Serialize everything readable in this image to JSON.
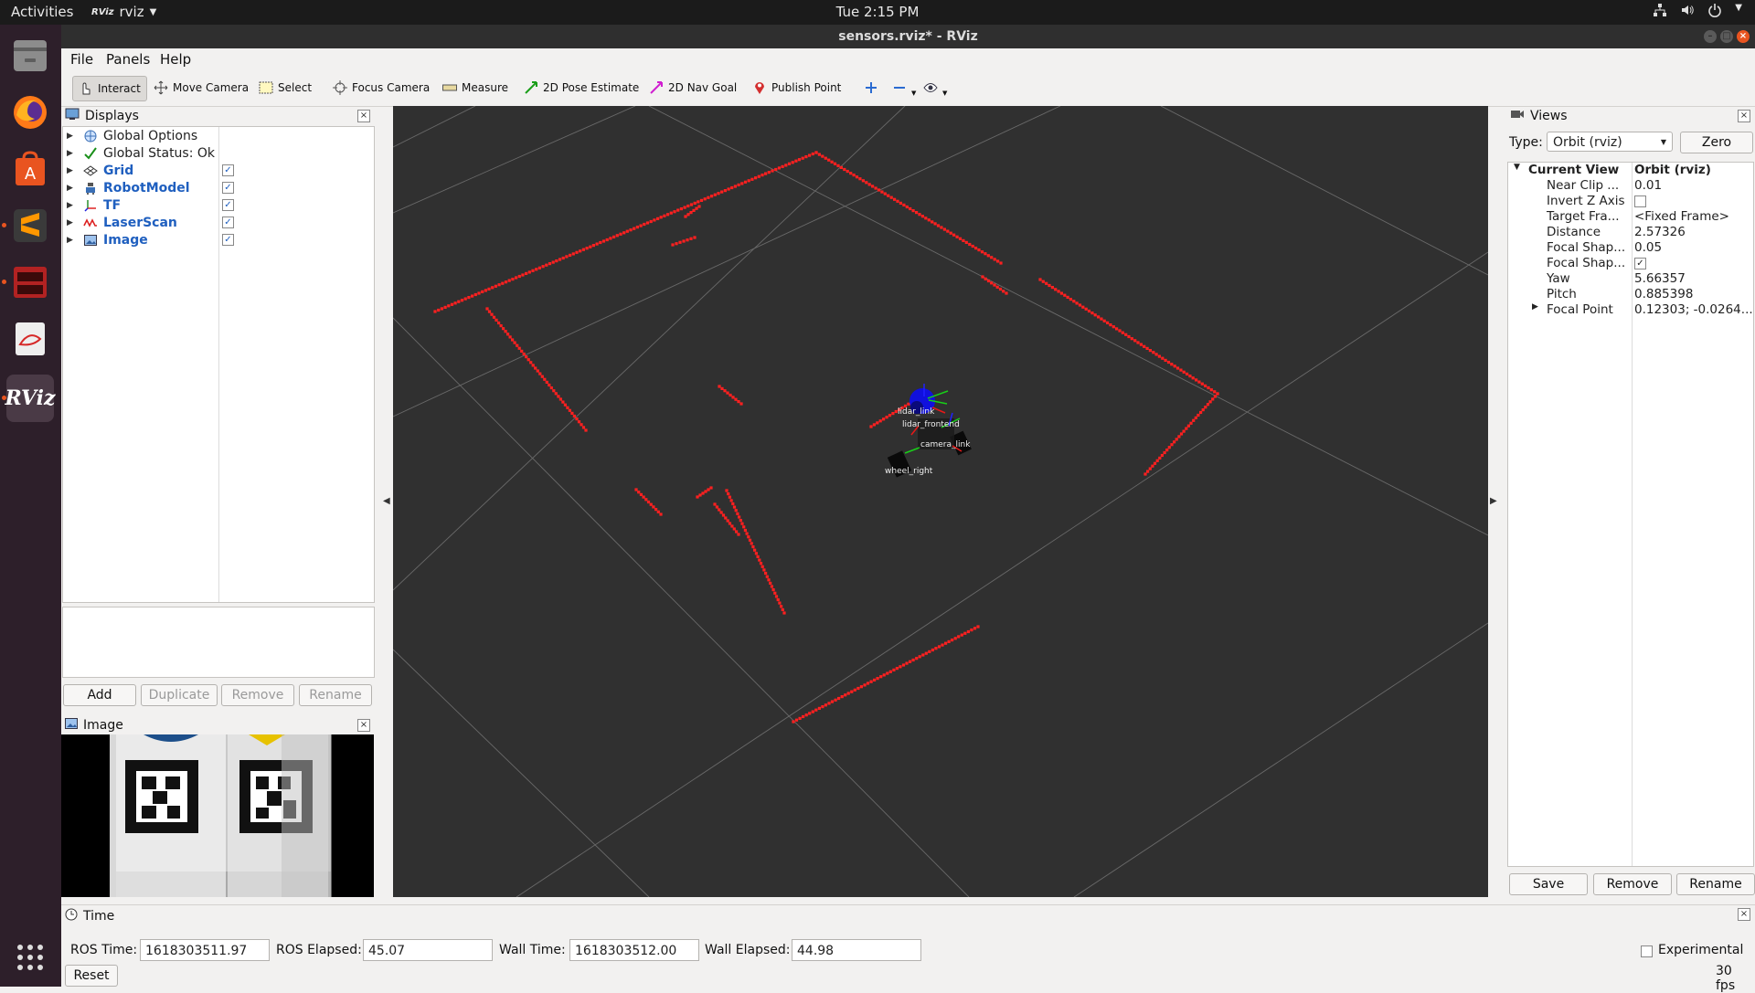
{
  "topbar": {
    "activities": "Activities",
    "app_name": "rviz",
    "app_icon_text": "RViz",
    "clock": "Tue  2:15 PM"
  },
  "window": {
    "title": "sensors.rviz* - RViz"
  },
  "menu": [
    "File",
    "Panels",
    "Help"
  ],
  "toolbar": {
    "interact": "Interact",
    "move_camera": "Move Camera",
    "select": "Select",
    "focus_camera": "Focus Camera",
    "measure": "Measure",
    "pose_estimate": "2D Pose Estimate",
    "nav_goal": "2D Nav Goal",
    "publish_point": "Publish Point"
  },
  "displays": {
    "title": "Displays",
    "items": [
      {
        "label": "Global Options",
        "checked": null
      },
      {
        "label": "Global Status: Ok",
        "checked": null
      },
      {
        "label": "Grid",
        "checked": true
      },
      {
        "label": "RobotModel",
        "checked": true
      },
      {
        "label": "TF",
        "checked": true
      },
      {
        "label": "LaserScan",
        "checked": true
      },
      {
        "label": "Image",
        "checked": true
      }
    ],
    "buttons": {
      "add": "Add",
      "duplicate": "Duplicate",
      "remove": "Remove",
      "rename": "Rename"
    }
  },
  "image_panel": {
    "title": "Image"
  },
  "viewport": {
    "tf_labels": [
      "lidar_link",
      "lidar_frontend",
      "camera_link",
      "wheel_right"
    ],
    "laser_color": "#ff2020",
    "grid_color": "#8a8a8a"
  },
  "views": {
    "title": "Views",
    "type_label": "Type:",
    "type_value": "Orbit (rviz)",
    "zero": "Zero",
    "rows": [
      {
        "key": "Current View",
        "value": "Orbit (rviz)"
      },
      {
        "key": "Near Clip ...",
        "value": "0.01"
      },
      {
        "key": "Invert Z Axis",
        "value": ""
      },
      {
        "key": "Target Fra...",
        "value": "<Fixed Frame>"
      },
      {
        "key": "Distance",
        "value": "2.57326"
      },
      {
        "key": "Focal Shap...",
        "value": "0.05"
      },
      {
        "key": "Focal Shap...",
        "value": ""
      },
      {
        "key": "Yaw",
        "value": "5.66357"
      },
      {
        "key": "Pitch",
        "value": "0.885398"
      },
      {
        "key": "Focal Point",
        "value": "0.12303; -0.0264..."
      }
    ],
    "buttons": {
      "save": "Save",
      "remove": "Remove",
      "rename": "Rename"
    }
  },
  "time": {
    "title": "Time",
    "ros_time_label": "ROS Time:",
    "ros_time": "1618303511.97",
    "ros_elapsed_label": "ROS Elapsed:",
    "ros_elapsed": "45.07",
    "wall_time_label": "Wall Time:",
    "wall_time": "1618303512.00",
    "wall_elapsed_label": "Wall Elapsed:",
    "wall_elapsed": "44.98",
    "experimental": "Experimental",
    "reset": "Reset",
    "fps": "30 fps"
  }
}
